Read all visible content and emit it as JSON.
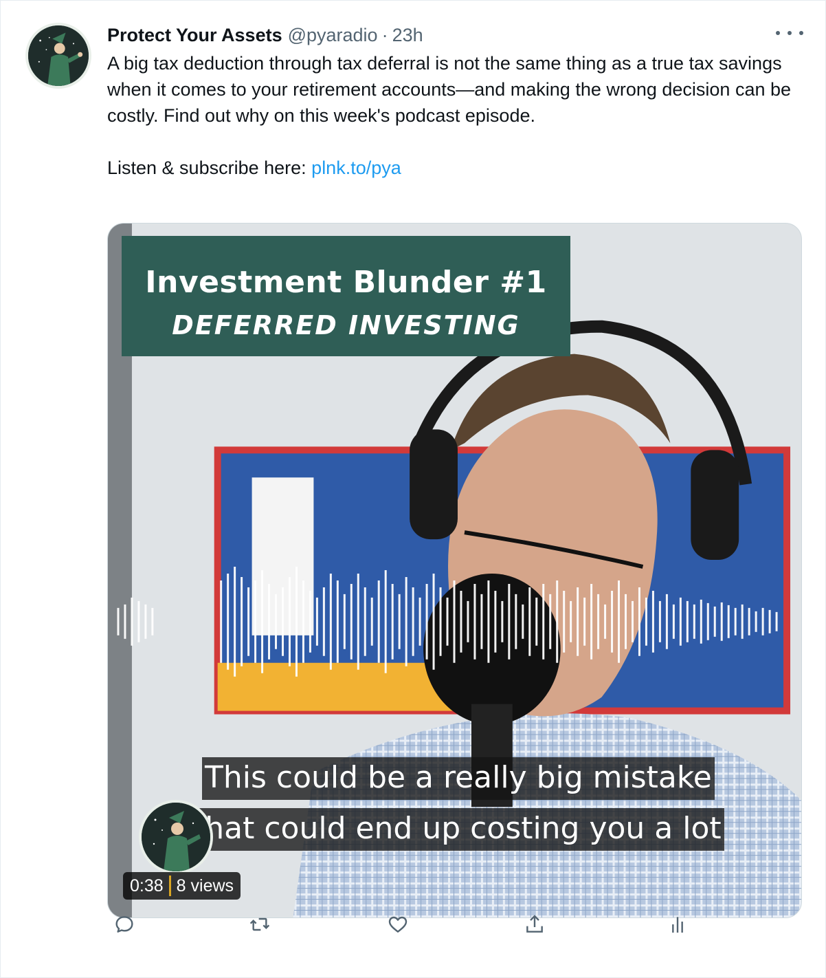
{
  "tweet": {
    "name": "Protect Your Assets",
    "handle": "@pyaradio",
    "dot": "·",
    "time": "23h",
    "body_line1": "A big tax deduction through tax deferral is not the same thing as a true tax savings when it comes to your retirement accounts—and making the wrong decision can be costly. Find out why on this week's podcast episode.",
    "body_line2_prefix": "Listen & subscribe here: ",
    "link_text": "plnk.to/pya"
  },
  "media": {
    "title_line1": "Investment Blunder #1",
    "title_line2": "DEFERRED INVESTING",
    "caption_line1": "This could be a really big mistake",
    "caption_line2": "that could end up costing you a lot",
    "duration": "0:38",
    "views": "8 views"
  },
  "icons": {
    "more": "more-icon",
    "reply": "reply-icon",
    "retweet": "retweet-icon",
    "like": "heart-icon",
    "share": "share-icon",
    "analytics": "analytics-icon"
  },
  "colors": {
    "link": "#1d9bf0",
    "secondary_text": "#536471",
    "title_box": "#2f5e56"
  }
}
